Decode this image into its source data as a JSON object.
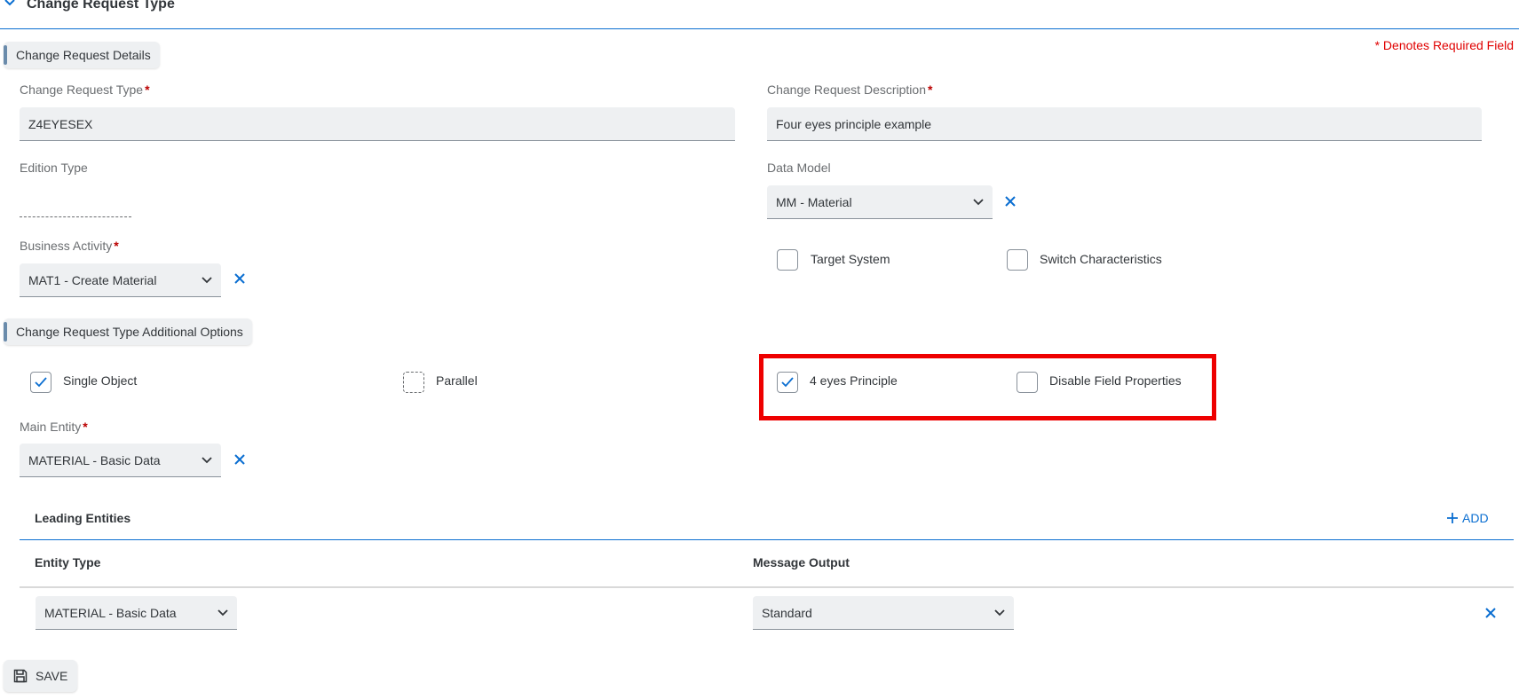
{
  "section": {
    "title": "Change Request Type",
    "required_note": "* Denotes Required Field"
  },
  "groups": {
    "details": "Change Request Details",
    "additional": "Change Request Type Additional Options"
  },
  "fields": {
    "cr_type": {
      "label": "Change Request Type",
      "value": "Z4EYESEX",
      "required": "*"
    },
    "cr_description": {
      "label": "Change Request Description",
      "value": "Four eyes principle example",
      "required": "*"
    },
    "edition_type": {
      "label": "Edition Type"
    },
    "data_model": {
      "label": "Data Model",
      "value": "MM - Material"
    },
    "business_activity": {
      "label": "Business Activity",
      "value": "MAT1 - Create Material",
      "required": "*"
    },
    "main_entity": {
      "label": "Main Entity",
      "value": "MATERIAL - Basic Data",
      "required": "*"
    }
  },
  "checkboxes": {
    "target_system": {
      "label": "Target System",
      "checked": false
    },
    "switch_characteristics": {
      "label": "Switch Characteristics",
      "checked": false
    },
    "single_object": {
      "label": "Single Object",
      "checked": true
    },
    "parallel": {
      "label": "Parallel",
      "checked": false
    },
    "four_eyes": {
      "label": "4 eyes Principle",
      "checked": true
    },
    "disable_field_props": {
      "label": "Disable Field Properties",
      "checked": false
    }
  },
  "leading_entities": {
    "title": "Leading Entities",
    "add_label": "ADD",
    "columns": [
      "Entity Type",
      "Message Output"
    ],
    "rows": [
      {
        "entity_type": "MATERIAL - Basic Data",
        "message_output": "Standard"
      }
    ]
  },
  "footer": {
    "save_label": "SAVE"
  },
  "colors": {
    "accent": "#0a6ed1",
    "required": "#bb0000",
    "highlight": "#ee0000"
  }
}
